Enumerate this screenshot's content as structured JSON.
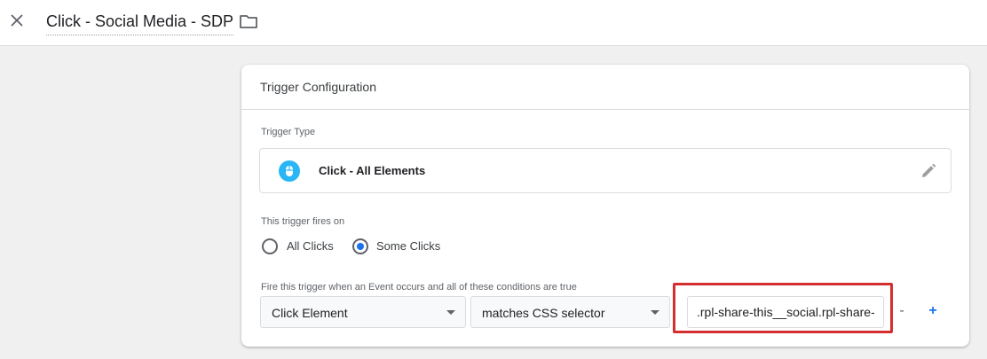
{
  "header": {
    "title": "Click - Social Media - SDP",
    "close_icon": "close-icon",
    "folder_icon": "folder-icon"
  },
  "card": {
    "title": "Trigger Configuration",
    "trigger_type_label": "Trigger Type",
    "trigger_type": {
      "name": "Click - All Elements",
      "icon": "click-icon",
      "icon_color": "#29b6f6"
    },
    "fires_on_label": "This trigger fires on",
    "options": [
      {
        "label": "All Clicks",
        "selected": false
      },
      {
        "label": "Some Clicks",
        "selected": true
      }
    ],
    "condition_label": "Fire this trigger when an Event occurs and all of these conditions are true",
    "condition": {
      "variable": "Click Element",
      "operator": "matches CSS selector",
      "value": ".rpl-share-this__social.rpl-share-this"
    },
    "remove_label": "-",
    "add_label": "+"
  },
  "colors": {
    "accent": "#1a73e8",
    "highlight": "#d32f2f"
  }
}
